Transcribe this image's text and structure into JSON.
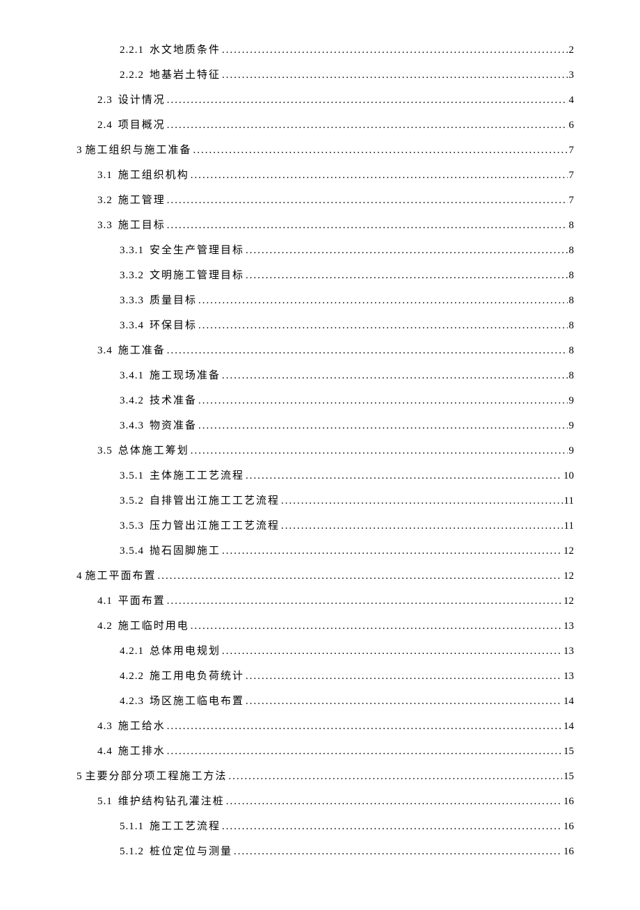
{
  "toc": [
    {
      "indent": 2,
      "num": "2.2.1",
      "title": "水文地质条件",
      "page": "2"
    },
    {
      "indent": 2,
      "num": "2.2.2",
      "title": "地基岩土特征",
      "page": "3"
    },
    {
      "indent": 1,
      "num": "2.3",
      "title": "设计情况",
      "page": "4"
    },
    {
      "indent": 1,
      "num": "2.4",
      "title": "项目概况",
      "page": "6"
    },
    {
      "indent": 0,
      "num": "3",
      "title": "施工组织与施工准备",
      "page": "7"
    },
    {
      "indent": 1,
      "num": "3.1",
      "title": "施工组织机构",
      "page": "7"
    },
    {
      "indent": 1,
      "num": "3.2",
      "title": "施工管理",
      "page": "7"
    },
    {
      "indent": 1,
      "num": "3.3",
      "title": "施工目标",
      "page": "8"
    },
    {
      "indent": 2,
      "num": "3.3.1",
      "title": "安全生产管理目标",
      "page": "8"
    },
    {
      "indent": 2,
      "num": "3.3.2",
      "title": "文明施工管理目标",
      "page": "8"
    },
    {
      "indent": 2,
      "num": "3.3.3",
      "title": "质量目标",
      "page": "8"
    },
    {
      "indent": 2,
      "num": "3.3.4",
      "title": "环保目标",
      "page": "8"
    },
    {
      "indent": 1,
      "num": "3.4",
      "title": "施工准备",
      "page": "8"
    },
    {
      "indent": 2,
      "num": "3.4.1",
      "title": "施工现场准备",
      "page": "8"
    },
    {
      "indent": 2,
      "num": "3.4.2",
      "title": "技术准备",
      "page": "9"
    },
    {
      "indent": 2,
      "num": "3.4.3",
      "title": "物资准备",
      "page": "9"
    },
    {
      "indent": 1,
      "num": "3.5",
      "title": "总体施工筹划",
      "page": "9"
    },
    {
      "indent": 2,
      "num": "3.5.1",
      "title": "主体施工工艺流程",
      "page": "10"
    },
    {
      "indent": 2,
      "num": "3.5.2",
      "title": "自排管出江施工工艺流程",
      "page": "11"
    },
    {
      "indent": 2,
      "num": "3.5.3",
      "title": "压力管出江施工工艺流程",
      "page": "11"
    },
    {
      "indent": 2,
      "num": "3.5.4",
      "title": "抛石固脚施工",
      "page": "12"
    },
    {
      "indent": 0,
      "num": "4",
      "title": "施工平面布置",
      "page": "12"
    },
    {
      "indent": 1,
      "num": "4.1",
      "title": "平面布置",
      "page": "12"
    },
    {
      "indent": 1,
      "num": "4.2",
      "title": "施工临时用电",
      "page": "13"
    },
    {
      "indent": 2,
      "num": "4.2.1",
      "title": "总体用电规划",
      "page": "13"
    },
    {
      "indent": 2,
      "num": "4.2.2",
      "title": "施工用电负荷统计",
      "page": "13"
    },
    {
      "indent": 2,
      "num": "4.2.3",
      "title": "场区施工临电布置",
      "page": "14"
    },
    {
      "indent": 1,
      "num": "4.3",
      "title": "施工给水",
      "page": "14"
    },
    {
      "indent": 1,
      "num": "4.4",
      "title": "施工排水",
      "page": "15"
    },
    {
      "indent": 0,
      "num": "5",
      "title": "主要分部分项工程施工方法",
      "page": "15"
    },
    {
      "indent": 1,
      "num": "5.1",
      "title": "维护结构钻孔灌注桩",
      "page": "16"
    },
    {
      "indent": 2,
      "num": "5.1.1",
      "title": "施工工艺流程",
      "page": "16"
    },
    {
      "indent": 2,
      "num": "5.1.2",
      "title": "桩位定位与测量",
      "page": "16"
    }
  ]
}
